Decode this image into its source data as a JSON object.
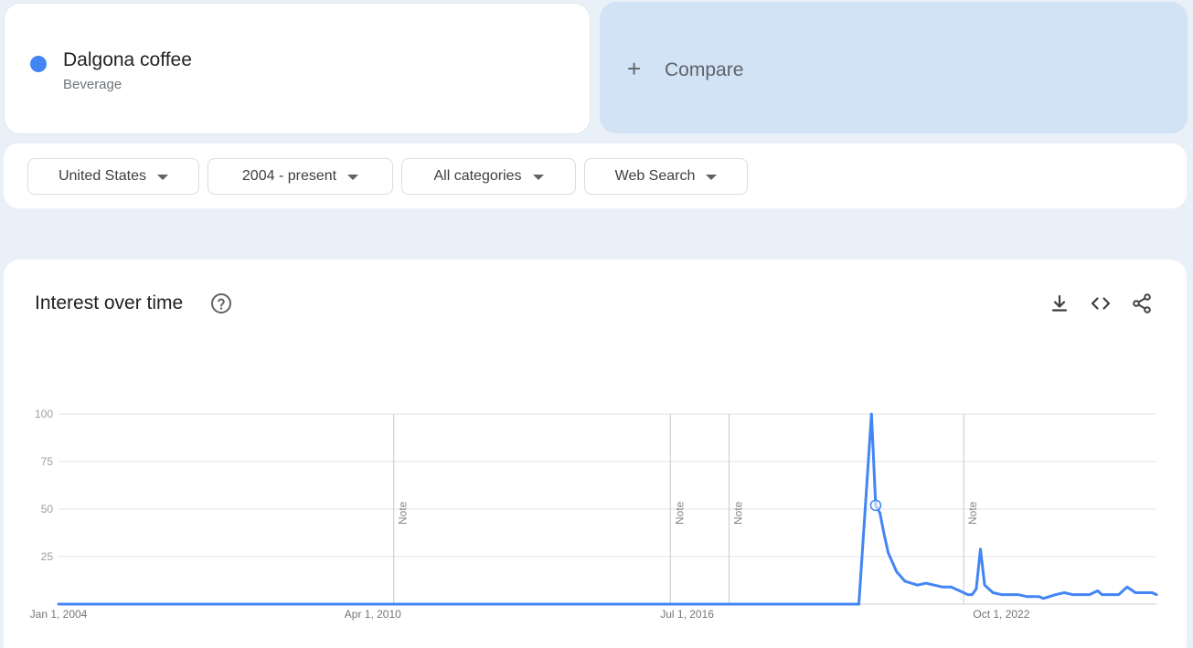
{
  "term": {
    "name": "Dalgona coffee",
    "type": "Beverage",
    "color": "#4285f4"
  },
  "compare": {
    "plus": "+",
    "label": "Compare"
  },
  "filters": [
    {
      "label": "United States"
    },
    {
      "label": "2004 - present"
    },
    {
      "label": "All categories"
    },
    {
      "label": "Web Search"
    }
  ],
  "chart": {
    "title": "Interest over time",
    "icons": [
      "help-icon",
      "download-icon",
      "embed-icon",
      "share-icon"
    ]
  },
  "chart_data": {
    "type": "line",
    "title": "",
    "xlabel": "",
    "ylabel": "",
    "ylim": [
      0,
      100
    ],
    "y_ticks": [
      "100",
      "75",
      "50",
      "25"
    ],
    "x_tick_labels": [
      "Jan 1, 2004",
      "Apr 1, 2010",
      "Jul 1, 2016",
      "Oct 1, 2022"
    ],
    "notes": [
      "Note",
      "Note",
      "Note",
      "Note"
    ],
    "series": [
      {
        "color": "#4285f4",
        "points": [
          [
            "2004-01",
            0
          ],
          [
            "2019-12",
            0
          ],
          [
            "2020-03",
            100
          ],
          [
            "2020-04",
            52
          ],
          [
            "2020-05",
            48
          ],
          [
            "2020-06",
            37
          ],
          [
            "2020-07",
            27
          ],
          [
            "2020-09",
            17
          ],
          [
            "2020-11",
            12
          ],
          [
            "2021-02",
            10
          ],
          [
            "2021-04",
            11
          ],
          [
            "2021-06",
            10
          ],
          [
            "2021-08",
            9
          ],
          [
            "2021-10",
            9
          ],
          [
            "2021-12",
            7
          ],
          [
            "2022-02",
            5
          ],
          [
            "2022-03",
            5
          ],
          [
            "2022-04",
            8
          ],
          [
            "2022-05",
            29
          ],
          [
            "2022-06",
            10
          ],
          [
            "2022-08",
            6
          ],
          [
            "2022-10",
            5
          ],
          [
            "2023-02",
            5
          ],
          [
            "2023-04",
            4
          ],
          [
            "2023-07",
            4
          ],
          [
            "2023-08",
            3
          ],
          [
            "2023-11",
            5
          ],
          [
            "2024-01",
            6
          ],
          [
            "2024-03",
            5
          ],
          [
            "2024-07",
            5
          ],
          [
            "2024-09",
            7
          ],
          [
            "2024-10",
            5
          ],
          [
            "2025-02",
            5
          ],
          [
            "2025-04",
            9
          ],
          [
            "2025-06",
            6
          ],
          [
            "2025-10",
            6
          ],
          [
            "2025-11",
            5
          ]
        ]
      }
    ],
    "highlight_point": [
      "2020-04",
      52
    ],
    "grid": true
  }
}
